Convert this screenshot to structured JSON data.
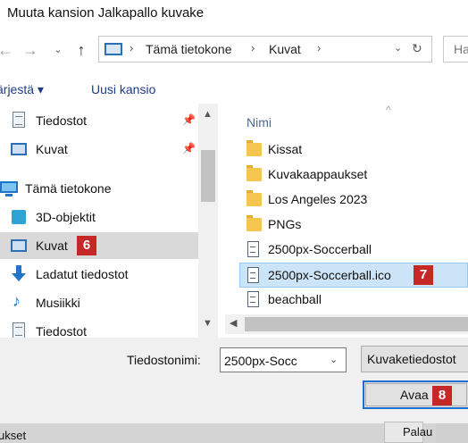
{
  "window": {
    "title": "Muuta kansion Jalkapallo kuvake"
  },
  "nav": {
    "back_icon": "arrow-left-icon",
    "forward_icon": "arrow-right-icon",
    "recent_icon": "chevron-down-icon",
    "up_icon": "arrow-up-icon",
    "breadcrumbs": [
      "Tämä tietokone",
      "Kuvat"
    ],
    "search_placeholder": "Ha"
  },
  "toolbar": {
    "organize_label": "ärjestä ▾",
    "new_folder_label": "Uusi kansio"
  },
  "sidebar": {
    "items": [
      {
        "label": "Tiedostot",
        "icon": "document-icon",
        "pinned": true
      },
      {
        "label": "Kuvat",
        "icon": "pictures-icon",
        "pinned": true
      },
      {
        "label": "Tämä tietokone",
        "icon": "computer-icon"
      },
      {
        "label": "3D-objektit",
        "icon": "cube-icon"
      },
      {
        "label": "Kuvat",
        "icon": "pictures-icon",
        "selected": true,
        "badge": "6"
      },
      {
        "label": "Ladatut tiedostot",
        "icon": "download-icon"
      },
      {
        "label": "Musiikki",
        "icon": "music-icon"
      },
      {
        "label": "Tiedostot",
        "icon": "document-icon"
      }
    ]
  },
  "filelist": {
    "column_name": "Nimi",
    "items": [
      {
        "label": "Kissat",
        "type": "folder"
      },
      {
        "label": "Kuvakaappaukset",
        "type": "folder"
      },
      {
        "label": "Los Angeles 2023",
        "type": "folder"
      },
      {
        "label": "PNGs",
        "type": "folder"
      },
      {
        "label": "2500px-Soccerball",
        "type": "file"
      },
      {
        "label": "2500px-Soccerball.ico",
        "type": "file",
        "selected": true,
        "badge": "7"
      },
      {
        "label": "beachball",
        "type": "file"
      }
    ]
  },
  "footer": {
    "filename_label": "Tiedostonimi:",
    "filename_value": "2500px-Socc",
    "filetype_value": "Kuvaketiedostot",
    "open_label": "Avaa",
    "open_badge": "8"
  },
  "background": {
    "left_text": "ukset",
    "right_text": "Palau"
  },
  "colors": {
    "accent": "#1e6fd2",
    "badge": "#c62828",
    "selection": "#cce4f7"
  }
}
